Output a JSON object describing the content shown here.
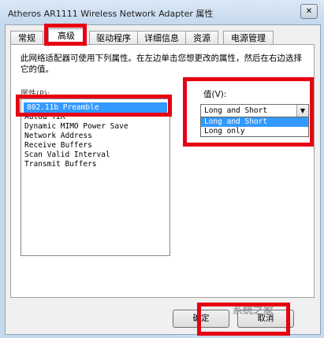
{
  "window": {
    "title": "Atheros AR1111 Wireless Network Adapter 属性",
    "close_glyph": "✕"
  },
  "tabs": [
    {
      "label": "常规"
    },
    {
      "label": "高级"
    },
    {
      "label": "驱动程序"
    },
    {
      "label": "详细信息"
    },
    {
      "label": "资源"
    },
    {
      "label": "电源管理"
    }
  ],
  "panel": {
    "description": "此网络适配器可使用下列属性。在左边单击您想更改的属性，然后在右边选择它的值。",
    "property_label": "属性(P):",
    "properties": [
      "802.11b Preamble",
      "AutoG TIR",
      "Dynamic MIMO Power Save",
      "Network Address",
      "Receive Buffers",
      "Scan Valid Interval",
      "Transmit Buffers"
    ],
    "value_label": "值(V):",
    "value_selected": "Long and Short",
    "value_options": [
      "Long and Short",
      "Long only"
    ]
  },
  "buttons": {
    "ok": "确定",
    "cancel": "取消"
  },
  "watermark": "系统之家",
  "colors": {
    "highlight_box": "#e60012",
    "selection": "#3399ff"
  }
}
